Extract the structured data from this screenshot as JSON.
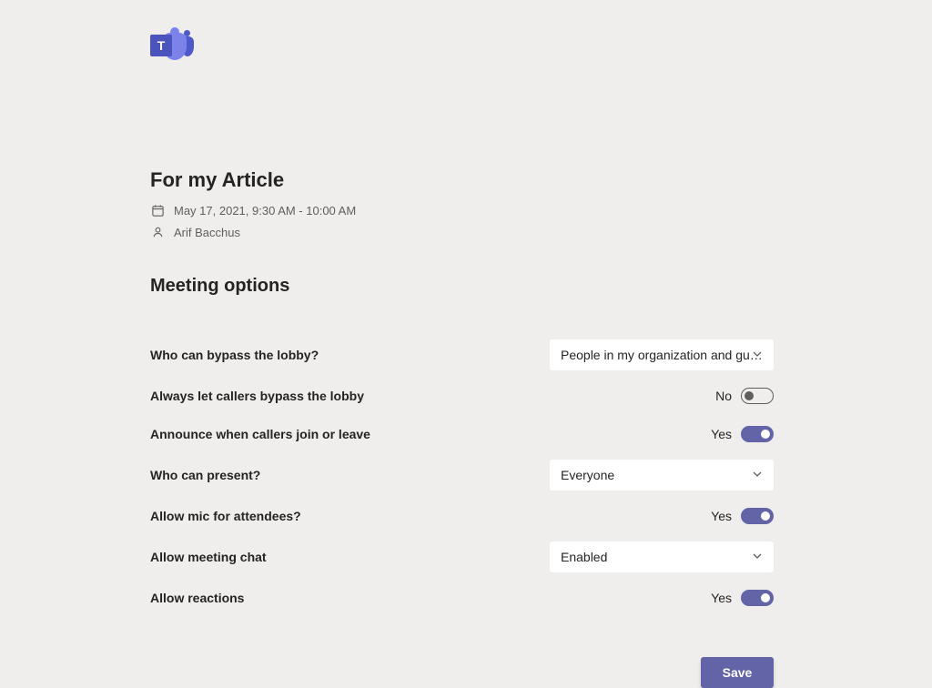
{
  "meeting": {
    "title": "For my Article",
    "datetime": "May 17, 2021, 9:30 AM - 10:00 AM",
    "organizer": "Arif Bacchus"
  },
  "section_title": "Meeting options",
  "options": {
    "bypass_lobby": {
      "label": "Who can bypass the lobby?",
      "value": "People in my organization and gu…"
    },
    "callers_bypass": {
      "label": "Always let callers bypass the lobby",
      "value": "No"
    },
    "announce": {
      "label": "Announce when callers join or leave",
      "value": "Yes"
    },
    "present": {
      "label": "Who can present?",
      "value": "Everyone"
    },
    "allow_mic": {
      "label": "Allow mic for attendees?",
      "value": "Yes"
    },
    "meeting_chat": {
      "label": "Allow meeting chat",
      "value": "Enabled"
    },
    "reactions": {
      "label": "Allow reactions",
      "value": "Yes"
    }
  },
  "buttons": {
    "save": "Save"
  }
}
